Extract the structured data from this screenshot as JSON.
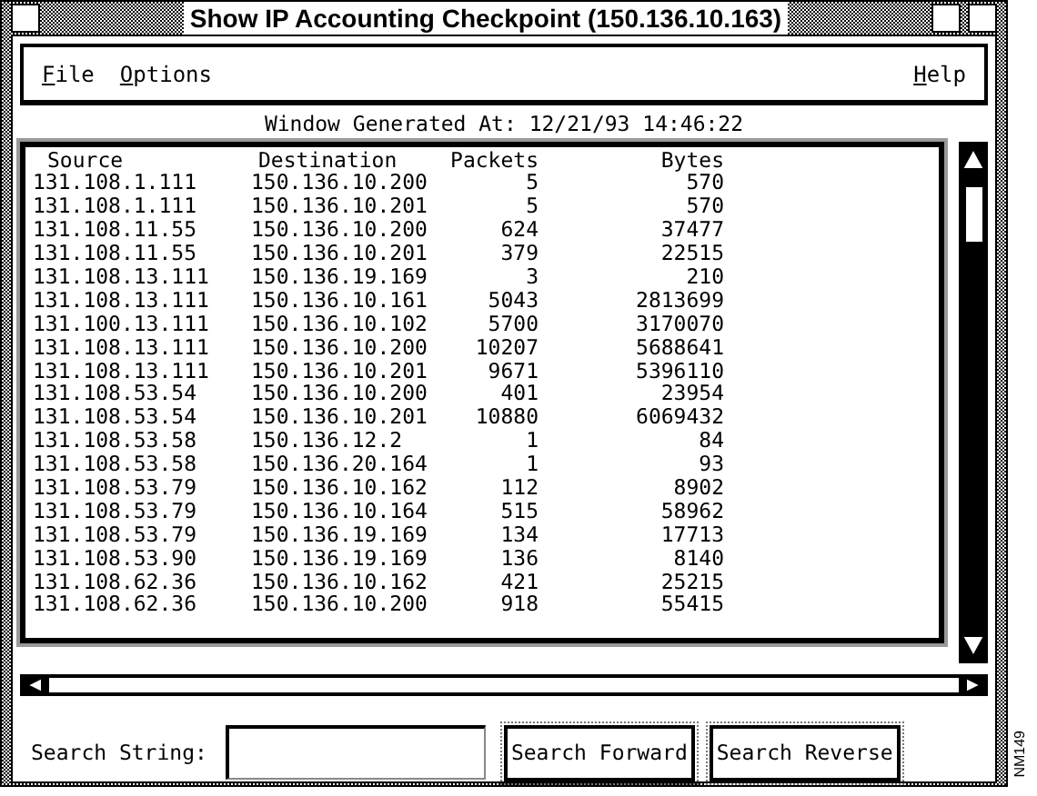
{
  "window": {
    "title": "Show IP Accounting Checkpoint (150.136.10.163)"
  },
  "menu": [
    {
      "label": "File"
    },
    {
      "label": "Options"
    },
    {
      "label": "Help"
    }
  ],
  "generated": "Window Generated At: 12/21/93 14:46:22",
  "table": {
    "columns": [
      "Source",
      "Destination",
      "Packets",
      "Bytes"
    ],
    "rows": [
      [
        "131.108.1.111",
        "150.136.10.200",
        "5",
        "570"
      ],
      [
        "131.108.1.111",
        "150.136.10.201",
        "5",
        "570"
      ],
      [
        "131.108.11.55",
        "150.136.10.200",
        "624",
        "37477"
      ],
      [
        "131.108.11.55",
        "150.136.10.201",
        "379",
        "22515"
      ],
      [
        "131.108.13.111",
        "150.136.19.169",
        "3",
        "210"
      ],
      [
        "131.108.13.111",
        "150.136.10.161",
        "5043",
        "2813699"
      ],
      [
        "131.100.13.111",
        "150.136.10.102",
        "5700",
        "3170070"
      ],
      [
        "131.108.13.111",
        "150.136.10.200",
        "10207",
        "5688641"
      ],
      [
        "131.108.13.111",
        "150.136.10.201",
        "9671",
        "5396110"
      ],
      [
        "131.108.53.54",
        "150.136.10.200",
        "401",
        "23954"
      ],
      [
        "131.108.53.54",
        "150.136.10.201",
        "10880",
        "6069432"
      ],
      [
        "131.108.53.58",
        "150.136.12.2",
        "1",
        "84"
      ],
      [
        "131.108.53.58",
        "150.136.20.164",
        "1",
        "93"
      ],
      [
        "131.108.53.79",
        "150.136.10.162",
        "112",
        "8902"
      ],
      [
        "131.108.53.79",
        "150.136.10.164",
        "515",
        "58962"
      ],
      [
        "131.108.53.79",
        "150.136.19.169",
        "134",
        "17713"
      ],
      [
        "131.108.53.90",
        "150.136.19.169",
        "136",
        "8140"
      ],
      [
        "131.108.62.36",
        "150.136.10.162",
        "421",
        "25215"
      ],
      [
        "131.108.62.36",
        "150.136.10.200",
        "918",
        "55415"
      ]
    ]
  },
  "search": {
    "label": "Search String:",
    "buttons": [
      "Search Forward",
      "Search Reverse"
    ]
  },
  "figure_id": "NM149"
}
